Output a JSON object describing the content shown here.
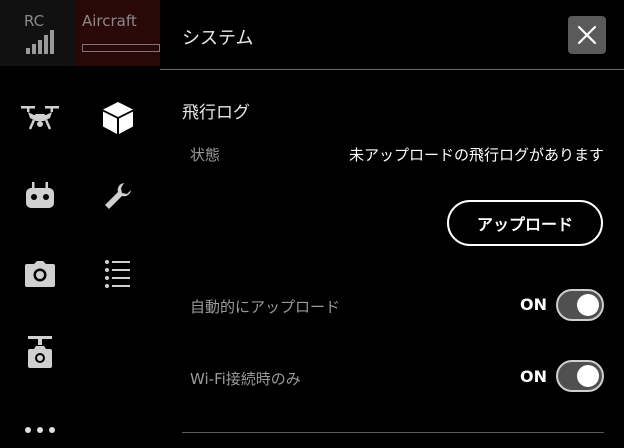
{
  "status_bar": {
    "rc_label": "RC",
    "aircraft_label": "Aircraft"
  },
  "sidebar": {
    "items": [
      {
        "icon": "drone-icon",
        "selected": false
      },
      {
        "icon": "cube-icon",
        "selected": true
      },
      {
        "icon": "remote-controller-icon",
        "selected": false
      },
      {
        "icon": "wrench-icon",
        "selected": false
      },
      {
        "icon": "camera-icon",
        "selected": false
      },
      {
        "icon": "list-icon",
        "selected": false
      },
      {
        "icon": "gimbal-camera-icon",
        "selected": false
      },
      {
        "icon": "more-icon",
        "selected": false
      }
    ]
  },
  "panel": {
    "title": "システム",
    "close_icon": "close-icon"
  },
  "flight_log": {
    "section_title": "飛行ログ",
    "status_label": "状態",
    "status_value": "未アップロードの飛行ログがあります",
    "upload_button": "アップロード",
    "auto_upload_label": "自動的にアップロード",
    "auto_upload_state": "ON",
    "wifi_only_label": "Wi-Fi接続時のみ",
    "wifi_only_state": "ON"
  },
  "colors": {
    "background": "#000000",
    "close_button_bg": "#5a5a5a",
    "label_gray": "#9a9a9a",
    "toggle_track": "#505050"
  }
}
